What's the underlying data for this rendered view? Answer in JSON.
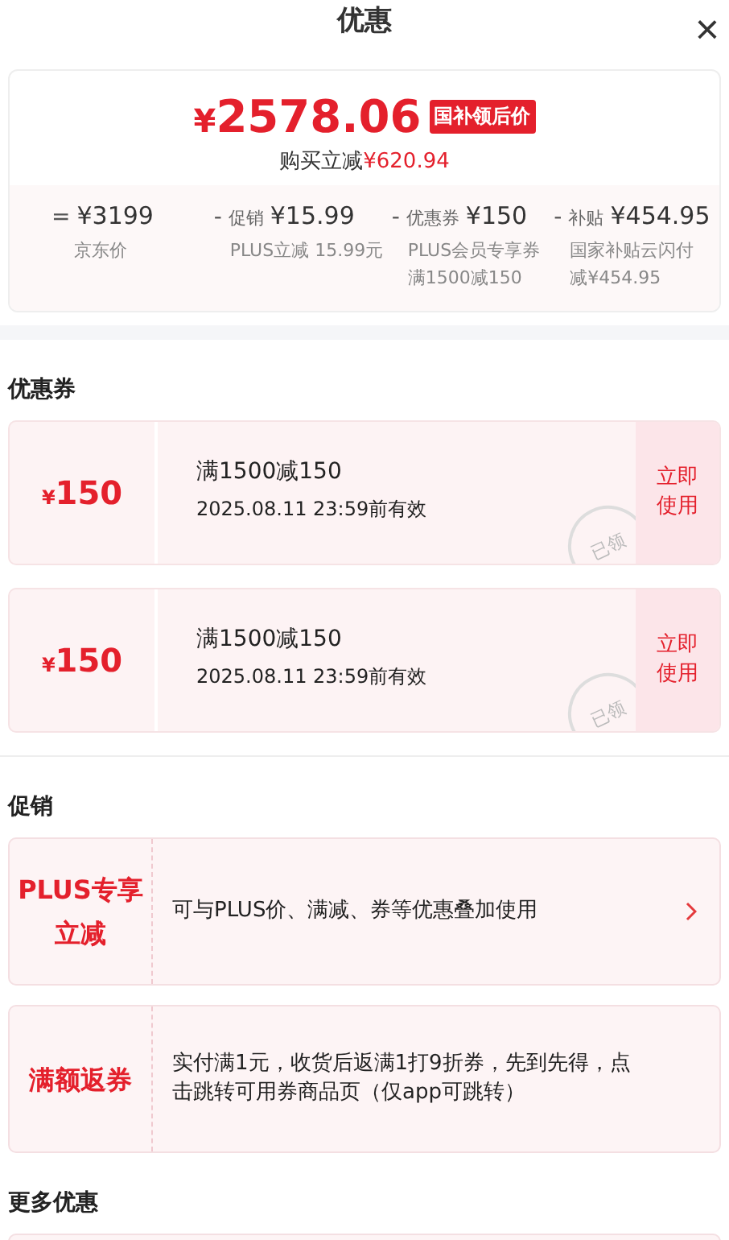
{
  "header": {
    "title": "优惠",
    "close": "×"
  },
  "summary": {
    "price_symbol": "¥",
    "price": "2578.06",
    "price_tag": "国补领后价",
    "saving_label": "购买立减",
    "saving": "¥620.94",
    "breakdown": [
      {
        "op": "=",
        "amount": "¥3199",
        "note": "京东价"
      },
      {
        "op": "-",
        "label": "促销",
        "amount": "¥15.99",
        "note": "PLUS立减 15.99元"
      },
      {
        "op": "-",
        "label": "优惠券",
        "amount": "¥150",
        "note": "PLUS会员专享券满1500减150"
      },
      {
        "op": "-",
        "label": "补贴",
        "amount": "¥454.95",
        "note": "国家补贴云闪付减¥454.95"
      }
    ]
  },
  "coupon_section": {
    "title": "优惠券",
    "coupons": [
      {
        "symbol": "¥",
        "value": "150",
        "condition": "满1500减150",
        "validity": "2025.08.11 23:59前有效",
        "action": "立即使用",
        "stamp": "已领"
      },
      {
        "symbol": "¥",
        "value": "150",
        "condition": "满1500减150",
        "validity": "2025.08.11 23:59前有效",
        "action": "立即使用",
        "stamp": "已领"
      }
    ]
  },
  "promo_section": {
    "title": "促销",
    "promos": [
      {
        "tag": "PLUS专享立减",
        "description": "可与PLUS价、满减、券等优惠叠加使用",
        "has_arrow": true
      },
      {
        "tag": "满额返券",
        "description": "实付满1元，收货后返满1打9折券，先到先得，点击跳转可用券商品页（仅app可跳转）",
        "has_arrow": false
      }
    ]
  },
  "more_section": {
    "title": "更多优惠"
  }
}
